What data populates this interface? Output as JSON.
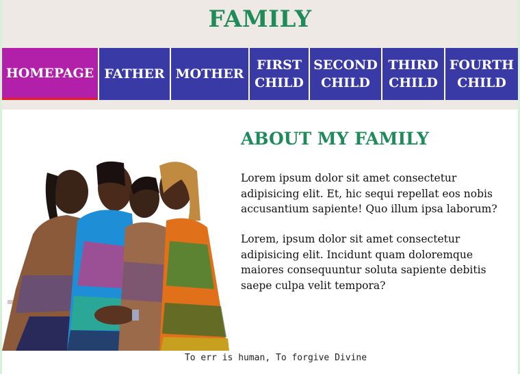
{
  "site": {
    "title": "FAMILY"
  },
  "nav": {
    "items": [
      {
        "label": "HOMEPAGE",
        "active": true
      },
      {
        "label": "FATHER"
      },
      {
        "label": "MOTHER"
      },
      {
        "label": "FIRST\nCHILD"
      },
      {
        "label": "SECOND\nCHILD"
      },
      {
        "label": "THIRD\nCHILD"
      },
      {
        "label": "FOURTH\nCHILD"
      }
    ]
  },
  "about": {
    "title": "ABOUT MY FAMILY",
    "paragraphs": [
      "Lorem ipsum dolor sit amet consectetur adipisicing elit. Et, hic sequi repellat eos nobis accusantium sapiente! Quo illum ipsa laborum?",
      "Lorem, ipsum dolor sit amet consectetur adipisicing elit. Incidunt quam doloremque maiores consequuntur soluta sapiente debitis saepe culpa velit tempora?"
    ]
  },
  "footer": {
    "text": "To err is human, To forgive Divine"
  },
  "colors": {
    "header_bg": "#efe9e6",
    "title_green": "#1f8a5a",
    "nav_blue": "#3a3aa6",
    "nav_active": "#b21fa9",
    "active_underline": "#e82020"
  }
}
